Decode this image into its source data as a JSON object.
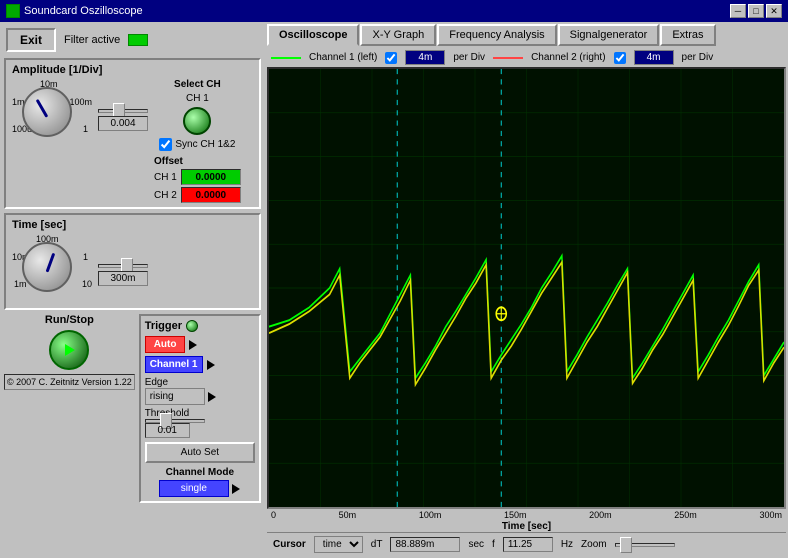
{
  "titleBar": {
    "title": "Soundcard Oszilloscope",
    "minBtn": "─",
    "maxBtn": "□",
    "closeBtn": "✕"
  },
  "leftPanel": {
    "exitBtn": "Exit",
    "filterLabel": "Filter active",
    "amplitudeTitle": "Amplitude [1/Div]",
    "selectCHLabel": "Select CH",
    "ch1Label": "CH 1",
    "syncLabel": "Sync CH 1&2",
    "offsetLabel": "Offset",
    "ch1Label2": "CH 1",
    "ch2Label": "CH 2",
    "ch1Value": "0.0000",
    "ch2Value": "0.0000",
    "knobLabels": {
      "top": "10m",
      "mid1": "1m",
      "bot1": "100u",
      "right1": "100m",
      "right2": "1"
    },
    "ampValue": "0.004",
    "timeTitle": "Time [sec]",
    "timeLabels": {
      "top": "100m",
      "mid1": "10m",
      "bot": "1m",
      "right1": "1",
      "right2": "10"
    },
    "timeValue": "300m",
    "triggerTitle": "Trigger",
    "triggerAuto": "Auto",
    "triggerChannel": "Channel 1",
    "edgeLabel": "Edge",
    "edgeValue": "rising",
    "thresholdLabel": "Threshold",
    "thresholdValue": "0.01",
    "autoSetBtn": "Auto Set",
    "channelModeLabel": "Channel Mode",
    "channelModeValue": "single",
    "runStopLabel": "Run/Stop",
    "copyright": "© 2007  C. Zeitnitz Version 1.22"
  },
  "tabs": [
    {
      "label": "Oscilloscope",
      "active": true
    },
    {
      "label": "X-Y Graph",
      "active": false
    },
    {
      "label": "Frequency Analysis",
      "active": false
    },
    {
      "label": "Signalgenerator",
      "active": false
    },
    {
      "label": "Extras",
      "active": false
    }
  ],
  "channelLegend": {
    "ch1Label": "Channel 1 (left)",
    "ch1PerDiv": "4m",
    "ch1PerDivUnit": "per Div",
    "ch2Label": "Channel 2 (right)",
    "ch2PerDiv": "4m",
    "ch2PerDivUnit": "per Div"
  },
  "xAxisLabels": [
    "0",
    "50m",
    "100m",
    "150m",
    "200m",
    "250m",
    "300m"
  ],
  "xAxisTitle": "Time [sec]",
  "statusBar": {
    "cursorLabel": "Cursor",
    "cursorType": "time",
    "dTLabel": "dT",
    "dTValue": "88.889m",
    "dTUnit": "sec",
    "fLabel": "f",
    "fValue": "11.25",
    "fUnit": "Hz",
    "zoomLabel": "Zoom"
  }
}
